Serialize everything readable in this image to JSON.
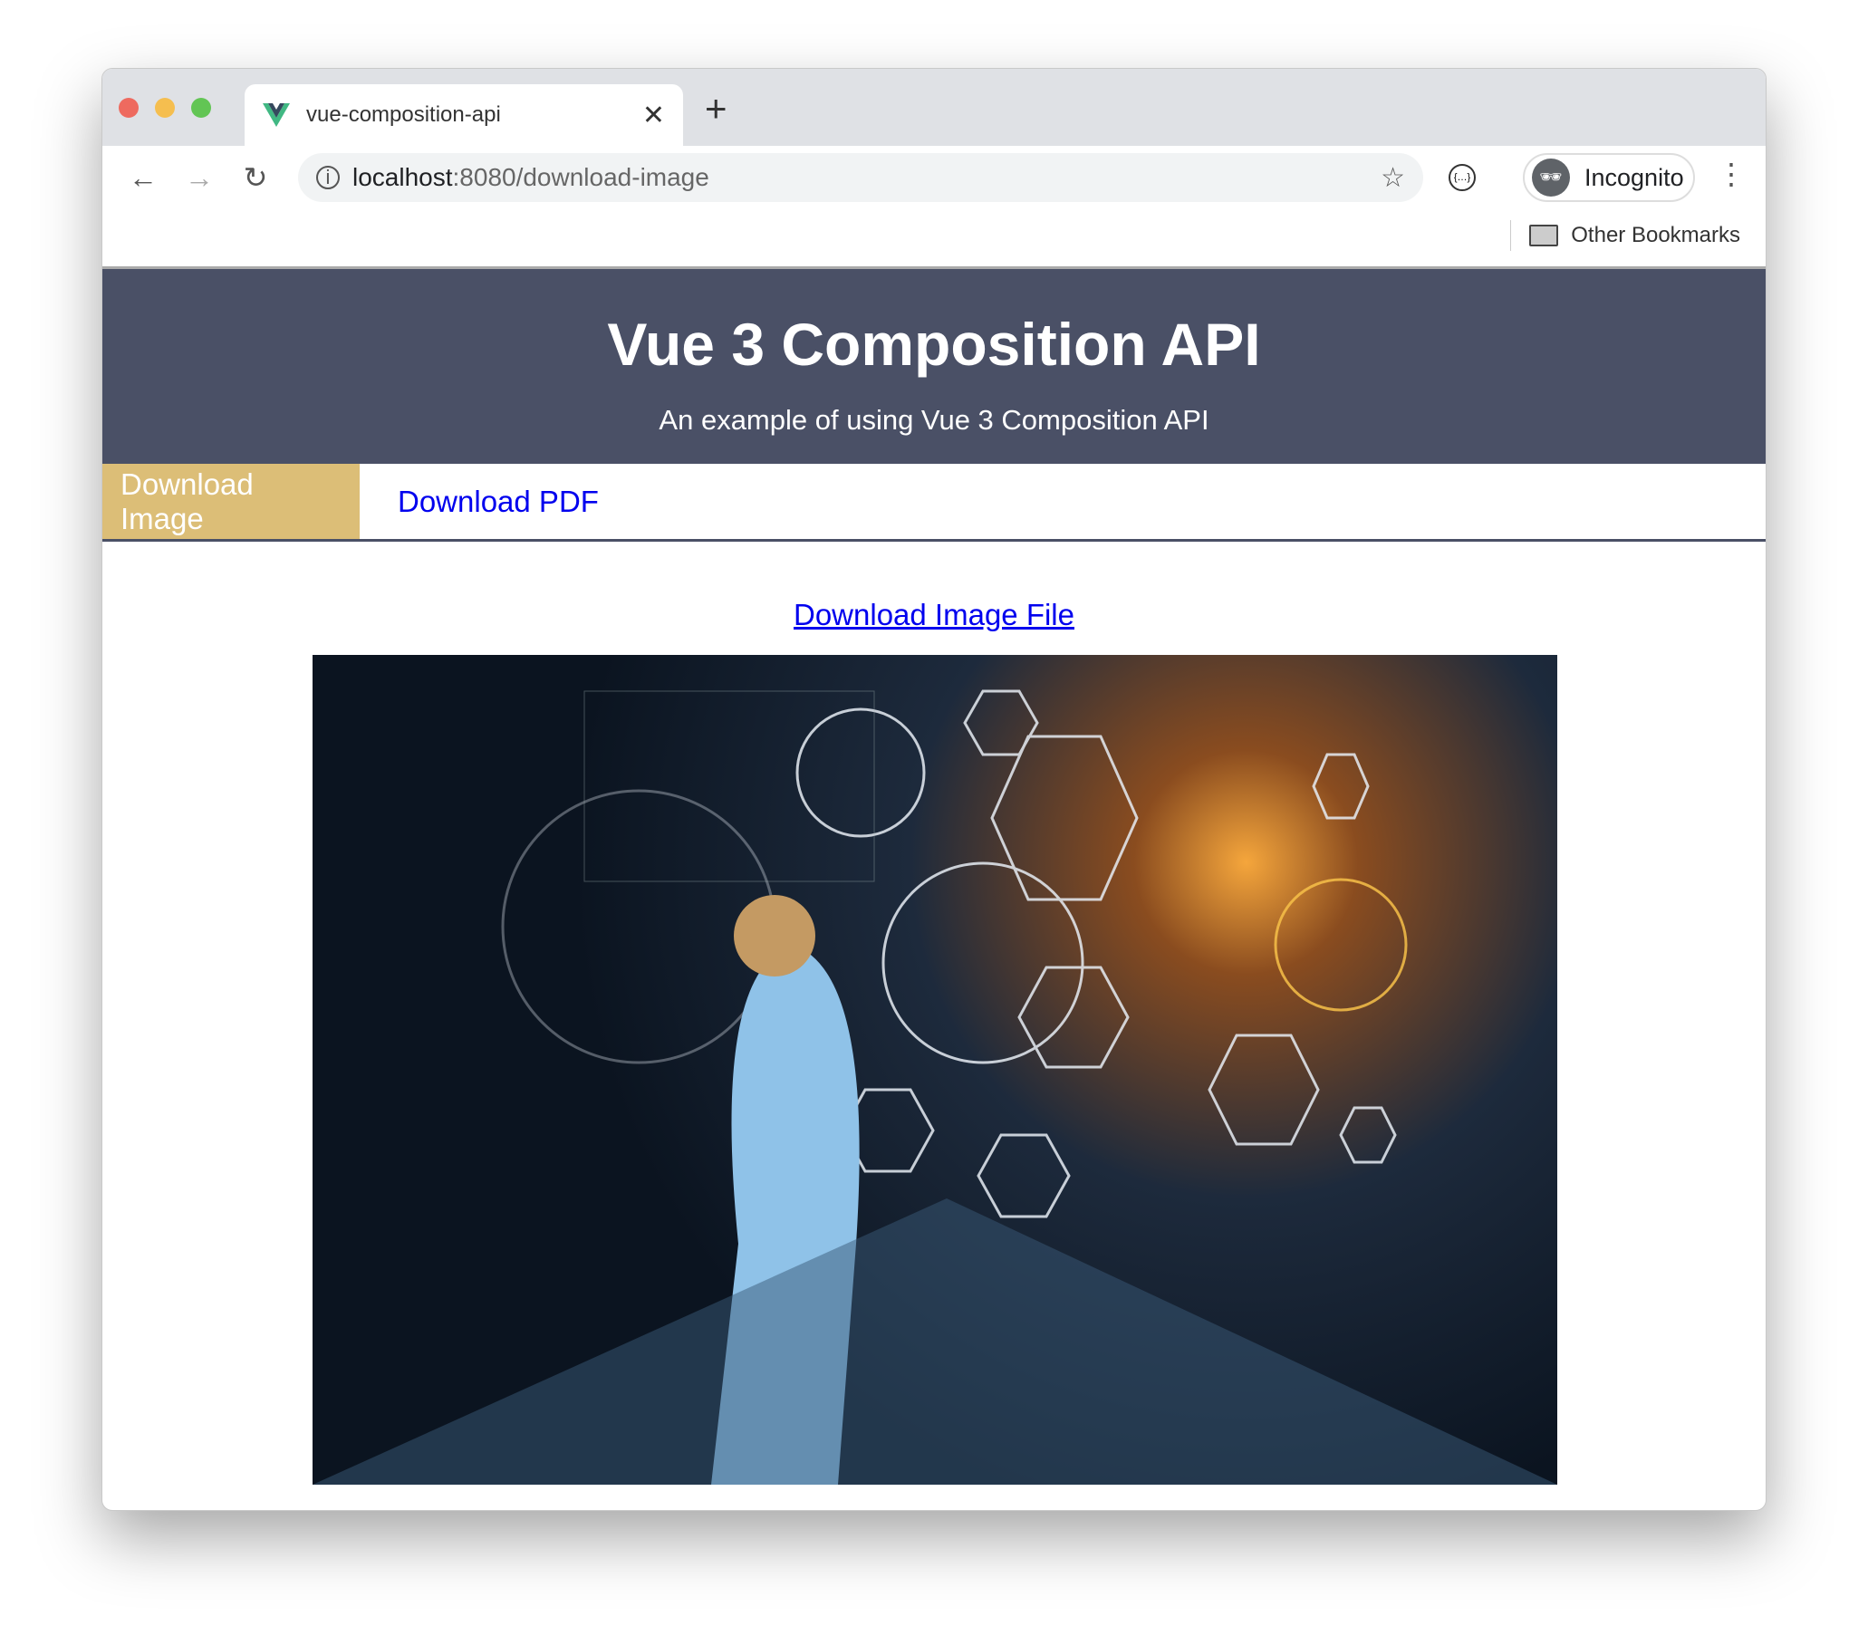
{
  "browser": {
    "tab_title": "vue-composition-api",
    "url_host": "localhost",
    "url_path": ":8080/download-image",
    "profile_label": "Incognito",
    "bookmarks_label": "Other Bookmarks"
  },
  "header": {
    "title": "Vue 3 Composition API",
    "subtitle": "An example of using Vue 3 Composition API"
  },
  "nav": {
    "items": [
      {
        "label": "Download Image",
        "active": true
      },
      {
        "label": "Download PDF",
        "active": false
      }
    ]
  },
  "main": {
    "download_link": "Download Image File"
  },
  "colors": {
    "header_bg": "#4a5066",
    "active_tab": "#dcbe77",
    "link": "#0000ee"
  }
}
